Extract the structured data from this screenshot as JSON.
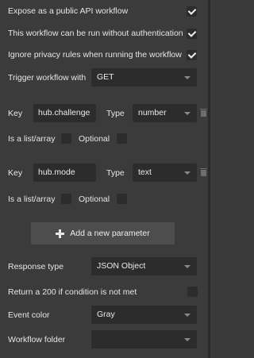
{
  "settings": {
    "expose_public": {
      "label": "Expose as a public API workflow",
      "checked": true
    },
    "no_auth": {
      "label": "This workflow can be run without authentication",
      "checked": true
    },
    "ignore_privacy": {
      "label": "Ignore privacy rules when running the workflow",
      "checked": true
    },
    "trigger": {
      "label": "Trigger workflow with",
      "value": "GET"
    }
  },
  "parameters": [
    {
      "key_label": "Key",
      "key_value": "hub.challenge",
      "type_label": "Type",
      "type_value": "number",
      "list_label": "Is a list/array",
      "optional_label": "Optional"
    },
    {
      "key_label": "Key",
      "key_value": "hub.mode",
      "type_label": "Type",
      "type_value": "text",
      "list_label": "Is a list/array",
      "optional_label": "Optional"
    }
  ],
  "add_parameter_label": "Add a new parameter",
  "response_type": {
    "label": "Response type",
    "value": "JSON Object"
  },
  "return_200": {
    "label": "Return a 200 if condition is not met",
    "checked": false
  },
  "event_color": {
    "label": "Event color",
    "value": "Gray"
  },
  "workflow_folder": {
    "label": "Workflow folder",
    "value": ""
  }
}
